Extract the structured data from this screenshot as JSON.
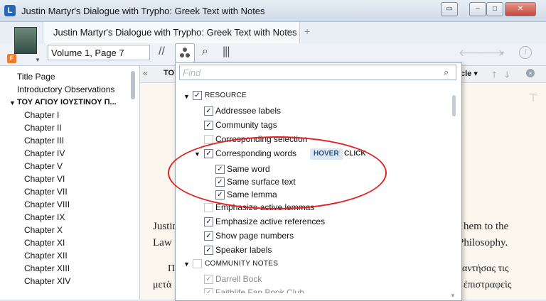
{
  "window": {
    "title": "Justin Martyr's Dialogue with Trypho: Greek Text with Notes",
    "app_icon": "logos-icon",
    "buttons": {
      "restore": "▭",
      "minimize": "–",
      "maximize": "□",
      "close": "✕"
    }
  },
  "tab": {
    "label": "Justin Martyr's Dialogue with Trypho: Greek Text with Notes",
    "close": "×",
    "add": "+",
    "badge": "F"
  },
  "toolbar": {
    "reference": "Volume 1, Page 7",
    "parallel_icon": "//",
    "search_icon": "⌕",
    "columns_icon": "|||",
    "back_icon": "🡐",
    "forward_icon": "🡒",
    "dropdown_icon": "▼",
    "info_icon": "i"
  },
  "toc": {
    "items": [
      {
        "label": "Title Page",
        "bold": false
      },
      {
        "label": "Introductory Observations",
        "bold": false
      },
      {
        "label": "ΤΟΥ ΑΓΙΟΥ ΙΟΥΣΤΙΝΟΥ Π...",
        "bold": true,
        "caret": "▼"
      },
      {
        "label": "Chapter I"
      },
      {
        "label": "Chapter II"
      },
      {
        "label": "Chapter III"
      },
      {
        "label": "Chapter IV"
      },
      {
        "label": "Chapter V"
      },
      {
        "label": "Chapter VI"
      },
      {
        "label": "Chapter VII"
      },
      {
        "label": "Chapter VIII"
      },
      {
        "label": "Chapter IX"
      },
      {
        "label": "Chapter X"
      },
      {
        "label": "Chapter XI"
      },
      {
        "label": "Chapter XII"
      },
      {
        "label": "Chapter XIII"
      },
      {
        "label": "Chapter XIV"
      }
    ]
  },
  "reader": {
    "nav_left": "«",
    "heading_left": "TOY",
    "heading_right": "cle ▾",
    "up": "🡑",
    "down": "🡓",
    "close": "×",
    "lines": [
      {
        "left": "Justin",
        "right": "hem to the"
      },
      {
        "left": "Law",
        "right": "Philosophy."
      },
      {
        "left": "Π",
        "right": "αντήσας τις"
      },
      {
        "left": "μετὰ",
        "right": "ἐπιστραφεὶς"
      }
    ]
  },
  "panel": {
    "find_placeholder": "Find",
    "options": [
      {
        "label": "RESOURCE",
        "header": true,
        "checked": true,
        "caret": "▼",
        "indent": 0
      },
      {
        "label": "Addressee labels",
        "checked": true,
        "indent": 1
      },
      {
        "label": "Community tags",
        "checked": true,
        "indent": 1
      },
      {
        "label": "Corresponding selection",
        "checked": false,
        "indent": 1
      },
      {
        "label": "Corresponding words",
        "checked": true,
        "indent": 1,
        "caret": "▼",
        "chips": [
          "HOVER",
          "CLICK"
        ]
      },
      {
        "label": "Same word",
        "checked": true,
        "indent": 2
      },
      {
        "label": "Same surface text",
        "checked": true,
        "indent": 2
      },
      {
        "label": "Same lemma",
        "checked": true,
        "indent": 2
      },
      {
        "label": "Emphasize active lemmas",
        "checked": false,
        "indent": 1
      },
      {
        "label": "Emphasize active references",
        "checked": true,
        "indent": 1
      },
      {
        "label": "Show page numbers",
        "checked": true,
        "indent": 1
      },
      {
        "label": "Speaker labels",
        "checked": true,
        "indent": 1
      },
      {
        "label": "COMMUNITY NOTES",
        "header": true,
        "checked": false,
        "caret": "▼",
        "indent": 0
      },
      {
        "label": "Darrell Bock",
        "checked": true,
        "indent": 1,
        "muted": true
      },
      {
        "label": "Faithlife Fan Book Club",
        "checked": true,
        "indent": 1,
        "muted": true
      }
    ]
  },
  "colors": {
    "annotation": "#e02424",
    "chip_hover": "#dde7f3"
  }
}
